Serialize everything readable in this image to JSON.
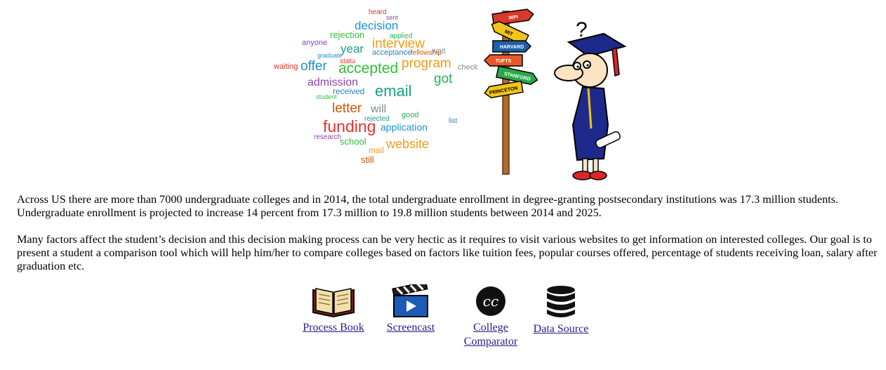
{
  "hero": {
    "wordcloud": {
      "words": [
        "heard",
        "decision",
        "rejection",
        "interview",
        "anyone",
        "year",
        "applied",
        "acceptance",
        "fellowship",
        "wait",
        "waiting",
        "offer",
        "accepted",
        "program",
        "admission",
        "email",
        "got",
        "received",
        "letter",
        "will",
        "funding",
        "application",
        "school",
        "website",
        "research",
        "rejected",
        "good",
        "list",
        "still",
        "check",
        "statu",
        "graduate",
        "student",
        "mail",
        "sent"
      ],
      "colors": [
        "#e3342f",
        "#1f8fd6",
        "#2fbf3a",
        "#f39c12",
        "#8e44ad",
        "#16a085",
        "#27ae60",
        "#2980b9",
        "#d35400",
        "#7f8c8d"
      ]
    },
    "signpost": {
      "signs": [
        "WPI",
        "MIT",
        "HARVARD",
        "TUFTS",
        "STANFORD",
        "PRINCETON"
      ],
      "sign_colors": [
        "#d73a2b",
        "#f2c618",
        "#1e5fa8",
        "#e8572a",
        "#29a845",
        "#f2c618"
      ]
    },
    "character": {
      "question_mark": "?"
    }
  },
  "intro": {
    "p1": "Across US there are more than 7000 undergraduate colleges and in 2014, the total undergraduate enrollment in degree-granting postsecondary institutions was 17.3 million students. Undergraduate enrollment is projected to increase 14 percent from 17.3 million to 19.8 million students between 2014 and 2025.",
    "p2": "Many factors affect the student’s decision and this decision making process can be very hectic as it requires to visit various websites to get information on interested colleges. Our goal is to present a student a comparison tool which will help him/her to compare colleges based on factors like tuition fees, popular courses offered, percentage of students receiving loan, salary after graduation etc."
  },
  "links": {
    "process_book": {
      "label": "Process Book",
      "icon": "open-book-icon"
    },
    "screencast": {
      "label": "Screencast",
      "icon": "clapperboard-icon"
    },
    "comparator": {
      "label_line1": "College",
      "label_line2": "Comparator",
      "icon": "cc-logo-icon"
    },
    "data_source": {
      "label": "Data Source",
      "icon": "database-icon"
    }
  }
}
